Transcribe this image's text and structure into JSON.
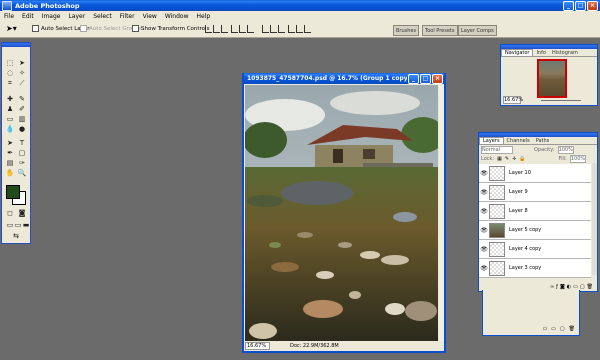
{
  "app": {
    "title": "Adobe Photoshop",
    "window_buttons": [
      "_",
      "□",
      "×"
    ]
  },
  "menu": [
    "File",
    "Edit",
    "Image",
    "Layer",
    "Select",
    "Filter",
    "View",
    "Window",
    "Help"
  ],
  "options_bar": {
    "auto_select_layer": "Auto Select Layer",
    "auto_select_groups": "Auto Select Groups",
    "show_transform_controls": "Show Transform Controls",
    "palette_tabs": [
      "Brushes",
      "Tool Presets",
      "Layer Comps"
    ]
  },
  "document": {
    "title": "1093875_47587704.psd @ 16.7% (Group 1 copy...",
    "zoom": "16.67%",
    "doc_info": "Doc: 22.9M/362.8M"
  },
  "navigator": {
    "tabs": [
      "Navigator",
      "Info",
      "Histogram"
    ],
    "zoom": "16.67%"
  },
  "layers_panel": {
    "tabs": [
      "Layers",
      "Channels",
      "Paths"
    ],
    "blend_mode": "Normal",
    "opacity_label": "Opacity:",
    "opacity_value": "100%",
    "lock_label": "Lock:",
    "fill_label": "Fill:",
    "fill_value": "100%",
    "layers": [
      {
        "name": "Layer 10",
        "thumb": "transparent"
      },
      {
        "name": "Layer 9",
        "thumb": "transparent"
      },
      {
        "name": "Layer 8",
        "thumb": "transparent"
      },
      {
        "name": "Layer 5 copy",
        "thumb": "photo"
      },
      {
        "name": "Layer 4 copy",
        "thumb": "transparent"
      },
      {
        "name": "Layer 3 copy",
        "thumb": "transparent"
      }
    ]
  },
  "colors": {
    "foreground": "#1f4a1c",
    "background": "#ffffff",
    "xp_blue": "#0a4fcf",
    "chrome": "#ece9d8",
    "workspace": "#6b6b6b"
  }
}
